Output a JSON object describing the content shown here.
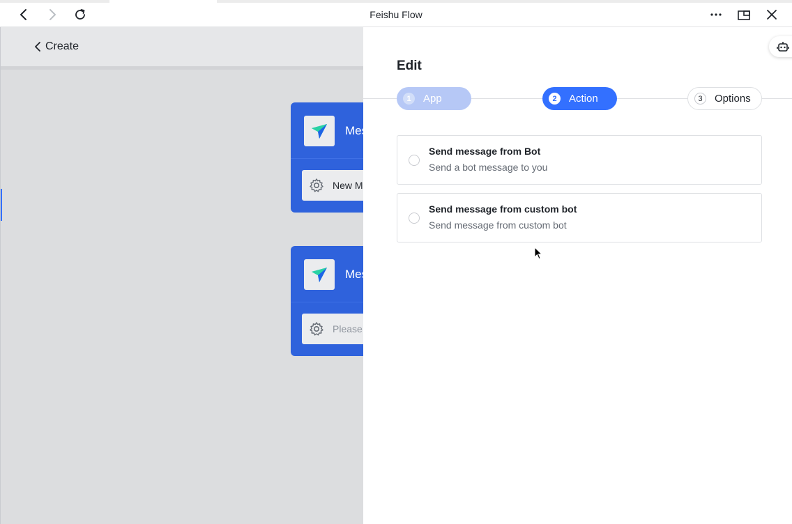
{
  "window": {
    "title": "Feishu Flow"
  },
  "background_app": {
    "back_label": "Create",
    "cards": [
      {
        "title": "Mes",
        "field_text": "New M"
      },
      {
        "title": "Mes",
        "field_text": "Please"
      }
    ]
  },
  "panel": {
    "title": "Edit",
    "steps": [
      {
        "number": "1",
        "label": "App"
      },
      {
        "number": "2",
        "label": "Action"
      },
      {
        "number": "3",
        "label": "Options"
      }
    ],
    "options": [
      {
        "title": "Send message from Bot",
        "description": "Send a bot message to you"
      },
      {
        "title": "Send message from custom bot",
        "description": "Send message from custom bot"
      }
    ]
  },
  "colors": {
    "accent": "#3370ff",
    "card_blue": "#2f62dc",
    "step_inactive": "#b6c8f6"
  }
}
